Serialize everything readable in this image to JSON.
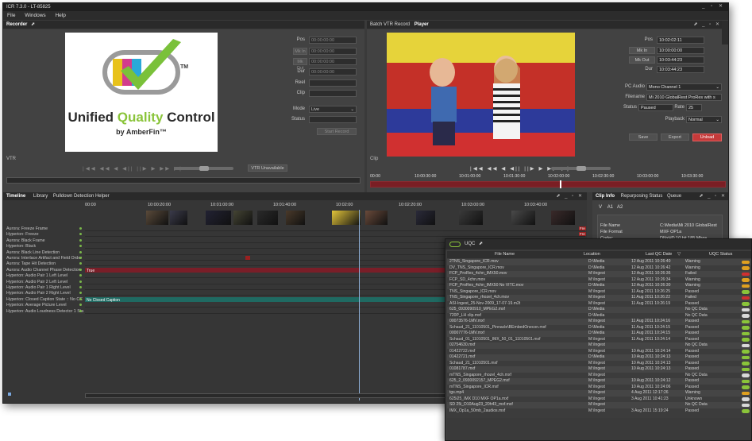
{
  "app": {
    "title": "ICR 7.3.0 - LT-85825",
    "menu": [
      "File",
      "Windows",
      "Help"
    ]
  },
  "recorder": {
    "panel_title": "Recorder",
    "fields": [
      {
        "label": "Pos",
        "value": "00:00:00:00"
      },
      {
        "label": "Mk In",
        "value": "00:00:00:00"
      },
      {
        "label": "Mk Out",
        "value": "00:00:00:00"
      },
      {
        "label": "Dur",
        "value": "00:00:00:00"
      },
      {
        "label": "Reel",
        "value": ""
      },
      {
        "label": "Clip",
        "value": ""
      }
    ],
    "mode_label": "Mode",
    "mode_value": "Live",
    "status_label": "Status",
    "status_value": "",
    "start_record": "Start Record",
    "vtr_label": "VTR",
    "vtr_unavailable": "VTR Unavailable",
    "logo_line1_a": "Unified ",
    "logo_line1_b": "Quality",
    "logo_line1_c": " Control",
    "logo_line2": "by AmberFin™",
    "logo_tm": "TM"
  },
  "player": {
    "tabs": [
      "Batch VTR Record",
      "Player"
    ],
    "fields": [
      {
        "label": "Pos",
        "value": "10:02:02:11"
      },
      {
        "label": "Mk In",
        "value": "10:00:00:00"
      },
      {
        "label": "Mk Out",
        "value": "10:03:44:23"
      },
      {
        "label": "Dur",
        "value": "10:03:44:23"
      }
    ],
    "pc_audio_label": "PC Audio",
    "pc_audio_value": "Mono Channel 1",
    "filename_label": "Filename",
    "filename_value": "Mi 2010 GlobalRest ProRes with s",
    "status_label": "Status",
    "status_value": "Paused",
    "rate_label": "Rate",
    "rate_value": "25",
    "playback_label": "Playback",
    "playback_value": "Normal",
    "buttons": [
      "Save",
      "Export",
      "Unload"
    ],
    "clip_label": "Clip",
    "ruler": [
      "00:00",
      "10:00:30:00",
      "10:01:00:00",
      "10:01:30:00",
      "10:02:00:00",
      "10:02:30:00",
      "10:03:00:00",
      "10:03:30:00"
    ]
  },
  "timeline": {
    "tabs": [
      "Timeline",
      "Library",
      "Pulldown Detection Helper"
    ],
    "ruler": [
      "00:00",
      "10:00:20:00",
      "10:01:00:00",
      "10:01:40:00",
      "10:02:00",
      "10:02:20:00",
      "10:03:00:00",
      "10:03:40:00"
    ],
    "tracks": [
      "Aurora: Freeze Frame",
      "Hyperion: Freeze",
      "Aurora: Black Frame",
      "Hyperion: Black",
      "Aurora: Black Line Detection",
      "Aurora: Interlace Artifact and Field Order",
      "Aurora: Tape Hit Detection",
      "Aurora: Audio Channel Phase Detection",
      "Hyperion: Audio Pair 1 Left Level",
      "Hyperion: Audio Pair 2 Left Level",
      "Hyperion: Audio Pair 1 Right Level",
      "Hyperion: Audio Pair 2 Right Level",
      "Hyperion: Closed Caption State :: No CC",
      "Hyperion: Average Picture Level",
      "Hyperion: Audio Loudness Detector 1 Sta"
    ],
    "true_label": "True",
    "cc_label": "No Closed Caption",
    "marker_labels": [
      "Fre",
      "Fre",
      "Bla"
    ]
  },
  "clip_info": {
    "tabs": [
      "Clip Info",
      "Repurposing Status",
      "Queue"
    ],
    "subtabs": [
      "V",
      "A1",
      "A2"
    ],
    "rows": [
      {
        "k": "File Name",
        "v": "C:\\Media\\Mi 2010 GlobalRest"
      },
      {
        "k": "File Format",
        "v": "MXF OP1a"
      },
      {
        "k": "Codec",
        "v": "DNxHD 10 bit 185 Mbps"
      }
    ]
  },
  "uqc": {
    "title": "UQC",
    "headers": [
      "File Name",
      "Location",
      "Last QC Date",
      "UQC Status"
    ],
    "rows": [
      {
        "name": "2TNS_Singapore_ICR.mov",
        "loc": "D:\\Media",
        "date": "12 Aug 2011 10:26:40",
        "status": "Warning",
        "c": "#e0a020"
      },
      {
        "name": "DV_TNS_Singapore_ICR.mov",
        "loc": "D:\\Media",
        "date": "12 Aug 2011 10:26:42",
        "status": "Warning",
        "c": "#e0a020"
      },
      {
        "name": "FCP_ProRes_4chn_IMX50.mov",
        "loc": "M:\\Ingest",
        "date": "12 Aug 2011 10:26:36",
        "status": "Failed",
        "c": "#d03030"
      },
      {
        "name": "FCP_SD_4chn.mov",
        "loc": "M:\\Ingest",
        "date": "12 Aug 2011 10:26:34",
        "status": "Warning",
        "c": "#e0a020"
      },
      {
        "name": "FCP_ProRes_4chn_IMX50 No VITC.mov",
        "loc": "D:\\Media",
        "date": "12 Aug 2011 10:26:30",
        "status": "Warning",
        "c": "#e0a020"
      },
      {
        "name": "TNS_Singapore_ICR.mov",
        "loc": "M:\\Ingest",
        "date": "11 Aug 2011 10:26:25",
        "status": "Passed",
        "c": "#8ac43a"
      },
      {
        "name": "TNS_Singapore_rhozel_4ch.mov",
        "loc": "M:\\Ingest",
        "date": "11 Aug 2011 10:26:22",
        "status": "Failed",
        "c": "#d03030"
      },
      {
        "name": "ASI-Ingest_25-Nov-2009_17-07-19.m2t",
        "loc": "M:\\Ingest",
        "date": "11 Aug 2011 10:26:19",
        "status": "Passed",
        "c": "#8ac43a"
      },
      {
        "name": "625_0930090910_MPEG2.mxf",
        "loc": "D:\\Media",
        "date": "",
        "status": "No QC Data",
        "c": "#d8d8d8"
      },
      {
        "name": "720P_LH clip.mxf",
        "loc": "D:\\Media",
        "date": "",
        "status": "No QC Data",
        "c": "#d8d8d8"
      },
      {
        "name": "00073576-1MV.mxf",
        "loc": "M:\\Ingest",
        "date": "11 Aug 2011 10:24:16",
        "status": "Passed",
        "c": "#8ac43a"
      },
      {
        "name": "Schaud_21_11010501_Pinnacle\\BEmbedOnecon.mxf",
        "loc": "D:\\Media",
        "date": "11 Aug 2011 10:24:15",
        "status": "Passed",
        "c": "#8ac43a"
      },
      {
        "name": "00007776-1MV.mxf",
        "loc": "D:\\Media",
        "date": "11 Aug 2011 10:24:15",
        "status": "Passed",
        "c": "#8ac43a"
      },
      {
        "name": "Schaud_01_11010501_IMX_50_01_11010501.mxf",
        "loc": "M:\\Ingest",
        "date": "11 Aug 2011 10:24:14",
        "status": "Passed",
        "c": "#8ac43a"
      },
      {
        "name": "02754630.mxf",
        "loc": "M:\\Ingest",
        "date": "",
        "status": "No QC Data",
        "c": "#d8d8d8"
      },
      {
        "name": "01422722.mxf",
        "loc": "M:\\Ingest",
        "date": "10 Aug 2011 10:24:14",
        "status": "Passed",
        "c": "#8ac43a"
      },
      {
        "name": "01422721.mxf",
        "loc": "D:\\Media",
        "date": "10 Aug 2011 10:24:13",
        "status": "Passed",
        "c": "#8ac43a"
      },
      {
        "name": "Schaud_21_11010501.mxf",
        "loc": "M:\\Ingest",
        "date": "10 Aug 2011 10:24:13",
        "status": "Passed",
        "c": "#8ac43a"
      },
      {
        "name": "01081787.mxf",
        "loc": "M:\\Ingest",
        "date": "10 Aug 2011 10:24:13",
        "status": "Passed",
        "c": "#8ac43a"
      },
      {
        "name": "mTNS_Singapore_rhozel_4ch.mxf",
        "loc": "M:\\Ingest",
        "date": "",
        "status": "No QC Data",
        "c": "#d8d8d8"
      },
      {
        "name": "625_2_0930092157_MPEG2.mxf",
        "loc": "M:\\Ingest",
        "date": "10 Aug 2011 10:24:12",
        "status": "Passed",
        "c": "#8ac43a"
      },
      {
        "name": "mTNS_Singapore_ICR.mxf",
        "loc": "M:\\Ingest",
        "date": "10 Aug 2011 10:24:06",
        "status": "Passed",
        "c": "#8ac43a"
      },
      {
        "name": "tgs.mp4",
        "loc": "M:\\Ingest",
        "date": "4 Aug 2011 12:17:26",
        "status": "Warning",
        "c": "#e0a020"
      },
      {
        "name": "625i25_IMX D10 MXF OP1a.mxf",
        "loc": "M:\\Ingest",
        "date": "3 Aug 2011 10:41:23",
        "status": "Unknown",
        "c": "#d8d8d8"
      },
      {
        "name": "SD 25i_D10Aug23_20h43_mxf.mxf",
        "loc": "M:\\Ingest",
        "date": "",
        "status": "No QC Data",
        "c": "#d8d8d8"
      },
      {
        "name": "IMX_Op1a_50mb_2audios.mxf",
        "loc": "M:\\Ingest",
        "date": "3 Aug 2011 15:19:24",
        "status": "Passed",
        "c": "#8ac43a"
      }
    ]
  }
}
